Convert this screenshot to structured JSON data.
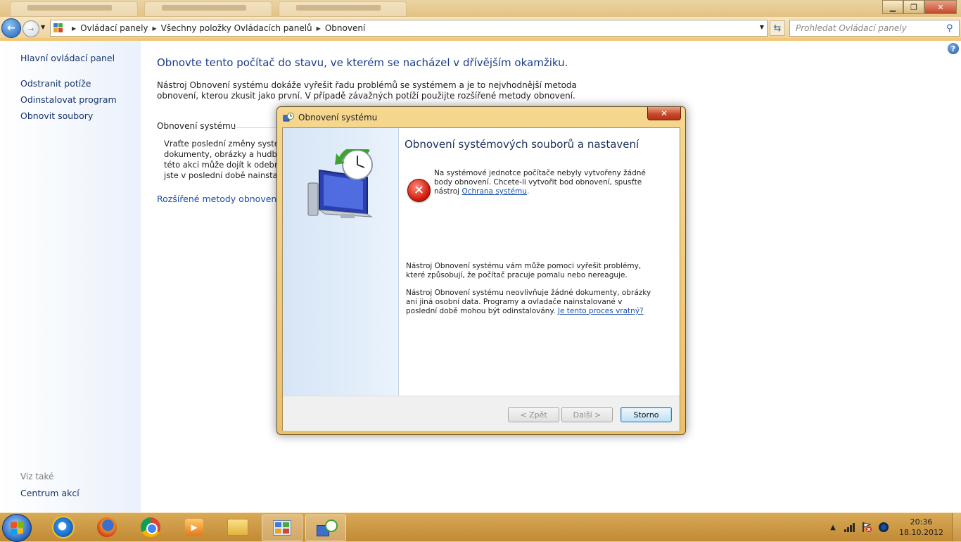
{
  "window": {
    "minimize_glyph": "▁",
    "maximize_glyph": "❐",
    "close_glyph": "✕"
  },
  "address": {
    "crumbs": [
      "Ovládací panely",
      "Všechny položky Ovládacích panelů",
      "Obnovení"
    ],
    "search_placeholder": "Prohledat Ovládací panely"
  },
  "sidebar": {
    "home": "Hlavní ovládací panel",
    "items": [
      "Odstranit potíže",
      "Odinstalovat program",
      "Obnovit soubory"
    ],
    "see_also_label": "Viz také",
    "see_also_items": [
      "Centrum akcí"
    ]
  },
  "main": {
    "title": "Obnovte tento počítač do stavu, ve kterém se nacházel v dřívějším okamžiku.",
    "intro": "Nástroj Obnovení systému dokáže vyřešit řadu problémů se systémem a je to nejvhodnější metoda obnovení, kterou zkusit jako první. V případě závažných potíží použijte rozšířené metody obnovení.",
    "section_title": "Obnovení systému",
    "section_lines": [
      "Vraťte poslední změny systém",
      "dokumenty, obrázky a hudbu)",
      "této akci může dojít k odebrán",
      "jste v poslední době nainstalov"
    ],
    "advanced_link": "Rozšířené metody obnovení"
  },
  "dialog": {
    "title": "Obnovení systému",
    "heading": "Obnovení systémových souborů a nastavení",
    "error_text": "Na systémové jednotce počítače nebyly vytvořeny žádné body obnovení. Chcete-li vytvořit bod obnovení, spusťte nástroj",
    "error_link": "Ochrana systému",
    "error_end": ".",
    "para1": "Nástroj Obnovení systému vám může pomoci vyřešit problémy, které způsobují, že počítač pracuje pomalu nebo nereaguje.",
    "para2": "Nástroj Obnovení systému neovlivňuje žádné dokumenty, obrázky ani jiná osobní data. Programy a ovladače nainstalované v poslední době mohou být odinstalovány.",
    "para2_link": "Je tento proces vratný?",
    "btn_back": "< Zpět",
    "btn_next": "Další >",
    "btn_cancel": "Storno",
    "close_glyph": "✕"
  },
  "taskbar": {
    "time": "20:36",
    "date": "18.10.2012",
    "tray_arrow": "▲"
  }
}
